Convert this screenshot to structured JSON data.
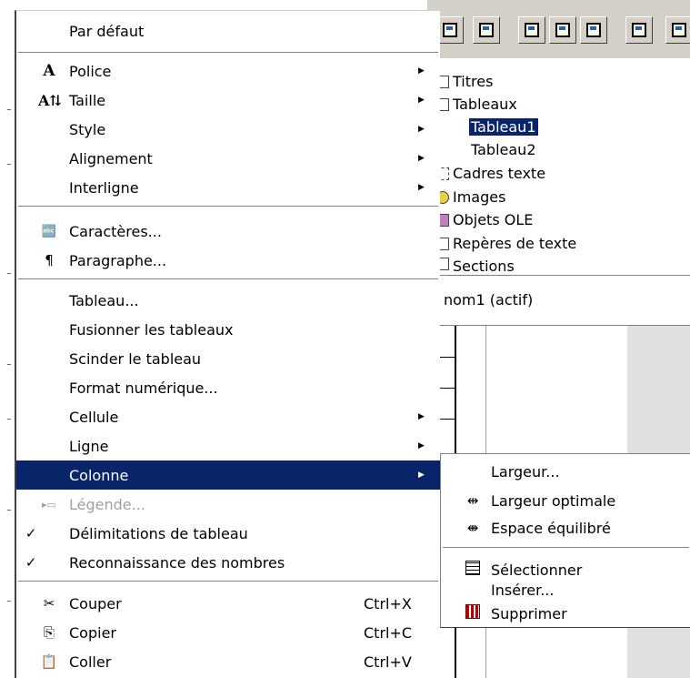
{
  "background": {
    "navigator": {
      "items": [
        {
          "icon": "headings-icon",
          "label": "Titres"
        },
        {
          "icon": "table-icon",
          "label": "Tableaux"
        },
        {
          "icon": "",
          "label": "Tableau1",
          "selected": true
        },
        {
          "icon": "",
          "label": "Tableau2"
        },
        {
          "icon": "text-frame-icon",
          "label": "Cadres texte"
        },
        {
          "icon": "image-icon",
          "label": "Images"
        },
        {
          "icon": "ole-object-icon",
          "label": "Objets OLE"
        },
        {
          "icon": "bookmark-icon",
          "label": "Repères de texte"
        },
        {
          "icon": "section-icon",
          "label": "Sections"
        }
      ]
    },
    "status_text": "nom1 (actif)"
  },
  "context_menu": {
    "default": "Par défaut",
    "police": "Police",
    "taille": "Taille",
    "style": "Style",
    "alignement": "Alignement",
    "interligne": "Interligne",
    "caracteres": "Caractères...",
    "paragraphe": "Paragraphe...",
    "tableau": "Tableau...",
    "fusionner": "Fusionner les tableaux",
    "scinder": "Scinder le tableau",
    "format_numerique": "Format numérique...",
    "cellule": "Cellule",
    "ligne": "Ligne",
    "colonne": "Colonne",
    "legende": "Légende...",
    "delimitations": "Délimitations de tableau",
    "reconnaissance": "Reconnaissance des nombres",
    "couper": "Couper",
    "copier": "Copier",
    "coller": "Coller",
    "shortcut_cut": "Ctrl+X",
    "shortcut_copy": "Ctrl+C",
    "shortcut_paste": "Ctrl+V",
    "checked_items": [
      "Délimitations de tableau",
      "Reconnaissance des nombres"
    ],
    "highlighted_item": "Colonne"
  },
  "submenu": {
    "largeur": "Largeur...",
    "largeur_optimale": "Largeur optimale",
    "espace_equilibre": "Espace équilibré",
    "selectionner": "Sélectionner",
    "inserer": "Insérer...",
    "supprimer": "Supprimer"
  },
  "colors": {
    "highlight": "#0a246a",
    "menu_bg": "#ffffff",
    "toolbar_bg": "#d4d0c8",
    "disabled": "#a0a0a0"
  }
}
